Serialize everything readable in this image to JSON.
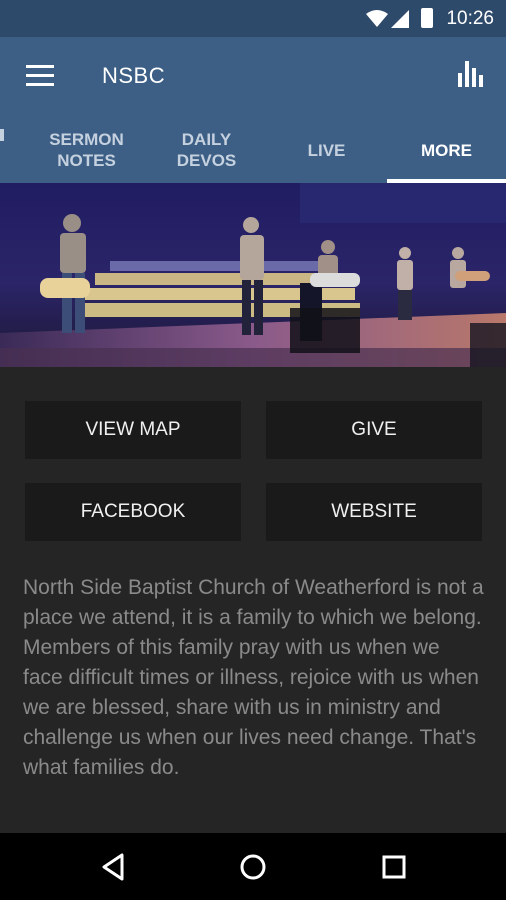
{
  "status_bar": {
    "time": "10:26"
  },
  "app_bar": {
    "title": "NSBC"
  },
  "tabs": [
    {
      "label": "SERMON\nNOTES"
    },
    {
      "label": "DAILY\nDEVOS"
    },
    {
      "label": "LIVE"
    },
    {
      "label": "MORE"
    }
  ],
  "active_tab": 3,
  "buttons": {
    "view_map": "VIEW MAP",
    "give": "GIVE",
    "facebook": "FACEBOOK",
    "website": "WEBSITE"
  },
  "description": "North Side Baptist Church of Weatherford is not a place we attend, it is a family to which we belong. Members of this family pray with us when we face difficult times or illness, rejoice with us when we are blessed, share with us in ministry and challenge us when our lives need change. That's what families do.",
  "colors": {
    "status_bar": "#2e4a6b",
    "app_bar": "#3d5f86",
    "background": "#252525",
    "button": "#1a1a1a",
    "description_text": "#8a8a8a"
  },
  "icons": [
    "menu-icon",
    "chart-icon",
    "wifi-icon",
    "signal-icon",
    "battery-icon",
    "back-icon",
    "home-icon",
    "recents-icon"
  ]
}
